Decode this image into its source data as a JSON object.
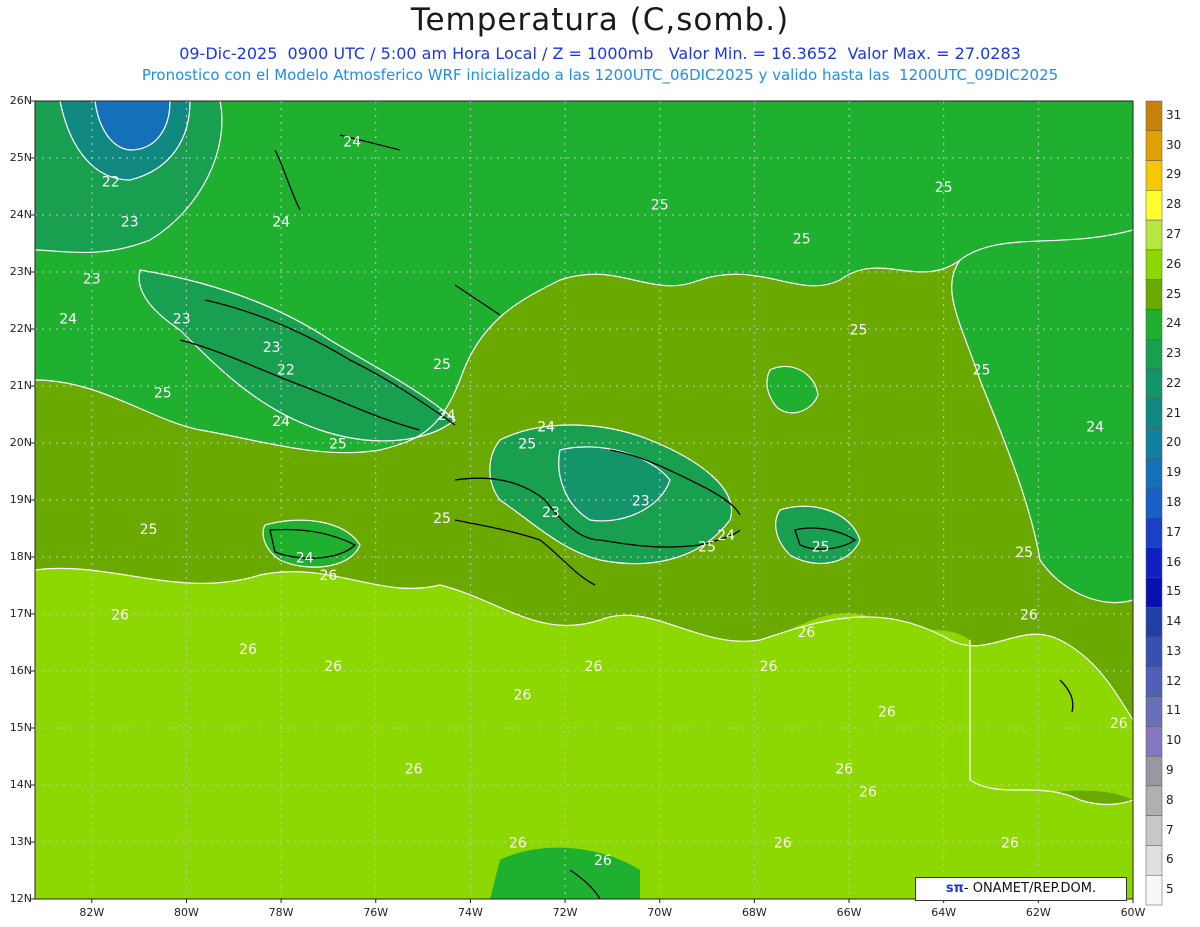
{
  "header": {
    "title": "Temperatura (C,somb.)",
    "line1": "09-Dic-2025  0900 UTC / 5:00 am Hora Local / Z = 1000mb   Valor Min. = 16.3652  Valor Max. = 27.0283",
    "line2": "Pronostico con el Modelo Atmosferico WRF inicializado a las 1200UTC_06DIC2025 y valido hasta las  1200UTC_09DIC2025"
  },
  "axes": {
    "lat_labels": [
      "26N",
      "25N",
      "24N",
      "23N",
      "22N",
      "21N",
      "20N",
      "19N",
      "18N",
      "17N",
      "16N",
      "15N",
      "14N",
      "13N",
      "12N"
    ],
    "lon_labels": [
      "82W",
      "80W",
      "78W",
      "76W",
      "74W",
      "72W",
      "70W",
      "68W",
      "66W",
      "64W",
      "62W",
      "60W"
    ],
    "lat_range": [
      12,
      26
    ],
    "lon_range": [
      -83.2,
      -60
    ]
  },
  "colorbar": {
    "labels": [
      "31",
      "30",
      "29",
      "28",
      "27",
      "26",
      "25",
      "24",
      "23",
      "22",
      "21",
      "20",
      "19",
      "18",
      "17",
      "16",
      "15",
      "14",
      "13",
      "12",
      "11",
      "10",
      "9",
      "8",
      "7",
      "6",
      "5"
    ],
    "colors": [
      "#c8820a",
      "#e0a000",
      "#f5c800",
      "#ffff30",
      "#b8e840",
      "#8cd800",
      "#6aaa00",
      "#20b030",
      "#18a050",
      "#14946a",
      "#108a80",
      "#1280a0",
      "#1470b8",
      "#1660c8",
      "#1a40c8",
      "#1020c0",
      "#0810b0",
      "#2040a8",
      "#3850b0",
      "#5060b8",
      "#6870b8",
      "#8878c0",
      "#9898a0",
      "#b0b0b0",
      "#c8c8c8",
      "#e0e0e0",
      "#f8f8f8"
    ]
  },
  "contour_labels": [
    "22",
    "23",
    "24",
    "25",
    "26"
  ],
  "regions": {
    "warm_band": "26",
    "mid_band": "25",
    "cool_band": "24"
  },
  "credit": {
    "symbol": "sπ",
    "text": "- ONAMET/REP.DOM."
  }
}
